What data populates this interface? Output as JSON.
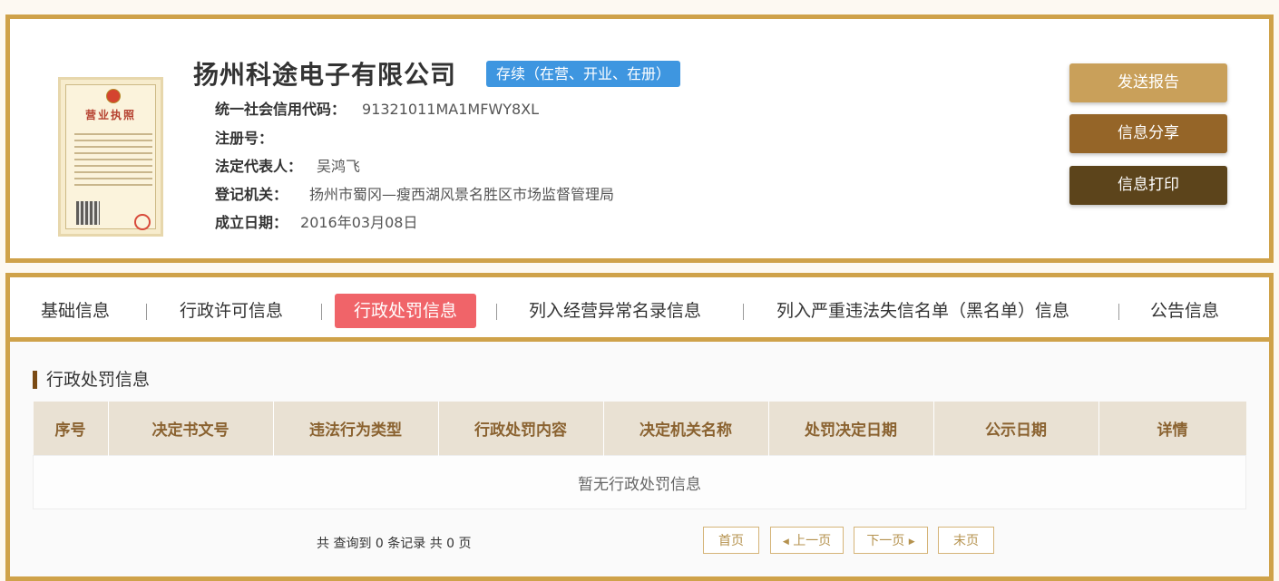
{
  "company": {
    "name": "扬州科途电子有限公司",
    "status": "存续（在营、开业、在册）",
    "license_image_alt": "营业执照",
    "fields": [
      {
        "label": "统一社会信用代码：",
        "value": "91321011MA1MFWY8XL"
      },
      {
        "label": "注册号：",
        "value": ""
      },
      {
        "label": "法定代表人：",
        "value": "吴鸿飞"
      },
      {
        "label": "登记机关：",
        "value": "扬州市蜀冈—瘦西湖风景名胜区市场监督管理局"
      },
      {
        "label": "成立日期：",
        "value": "2016年03月08日"
      }
    ]
  },
  "actions": {
    "send_report": "发送报告",
    "share_info": "信息分享",
    "print_info": "信息打印"
  },
  "tabs": [
    {
      "label": "基础信息",
      "active": false
    },
    {
      "label": "行政许可信息",
      "active": false
    },
    {
      "label": "行政处罚信息",
      "active": true
    },
    {
      "label": "列入经营异常名录信息",
      "active": false
    },
    {
      "label": "列入严重违法失信名单（黑名单）信息",
      "active": false
    },
    {
      "label": "公告信息",
      "active": false
    }
  ],
  "section": {
    "title": "行政处罚信息",
    "columns": [
      "序号",
      "决定书文号",
      "违法行为类型",
      "行政处罚内容",
      "决定机关名称",
      "处罚决定日期",
      "公示日期",
      "详情"
    ],
    "empty_text": "暂无行政处罚信息"
  },
  "pagination": {
    "summary": "共 查询到 0 条记录 共 0 页",
    "first": "首页",
    "prev": "上一页",
    "next": "下一页",
    "last": "末页"
  },
  "colors": {
    "accent_border": "#cfa24a",
    "status_badge": "#3e96e0",
    "active_tab": "#f06469",
    "btn_send": "#c9a05a",
    "btn_share": "#956528",
    "btn_print": "#5c441b"
  }
}
